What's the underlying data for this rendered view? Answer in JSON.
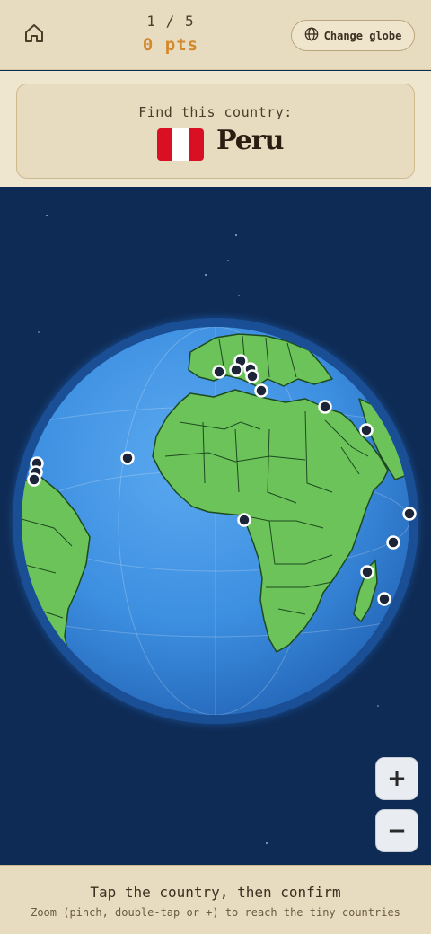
{
  "header": {
    "progress": "1 / 5",
    "score": "0 pts",
    "change_globe_label": "Change globe",
    "icons": {
      "home": "home-icon",
      "globe": "globe-icon"
    }
  },
  "target": {
    "prompt": "Find this country:",
    "country": "Peru",
    "flag_colors": [
      "#d91023",
      "#ffffff",
      "#d91023"
    ]
  },
  "zoom": {
    "in_label": "+",
    "out_label": "−"
  },
  "footer": {
    "instruction": "Tap the country, then confirm",
    "hint": "Zoom (pinch, double-tap or +) to reach the tiny countries"
  },
  "colors": {
    "cream": "#e8dcc0",
    "accent": "#d4882c",
    "space": "#0e2b55",
    "ocean": "#3c8ee0",
    "land": "#6cc35a",
    "border": "#1d4a1f",
    "marker": "#1c2538"
  }
}
